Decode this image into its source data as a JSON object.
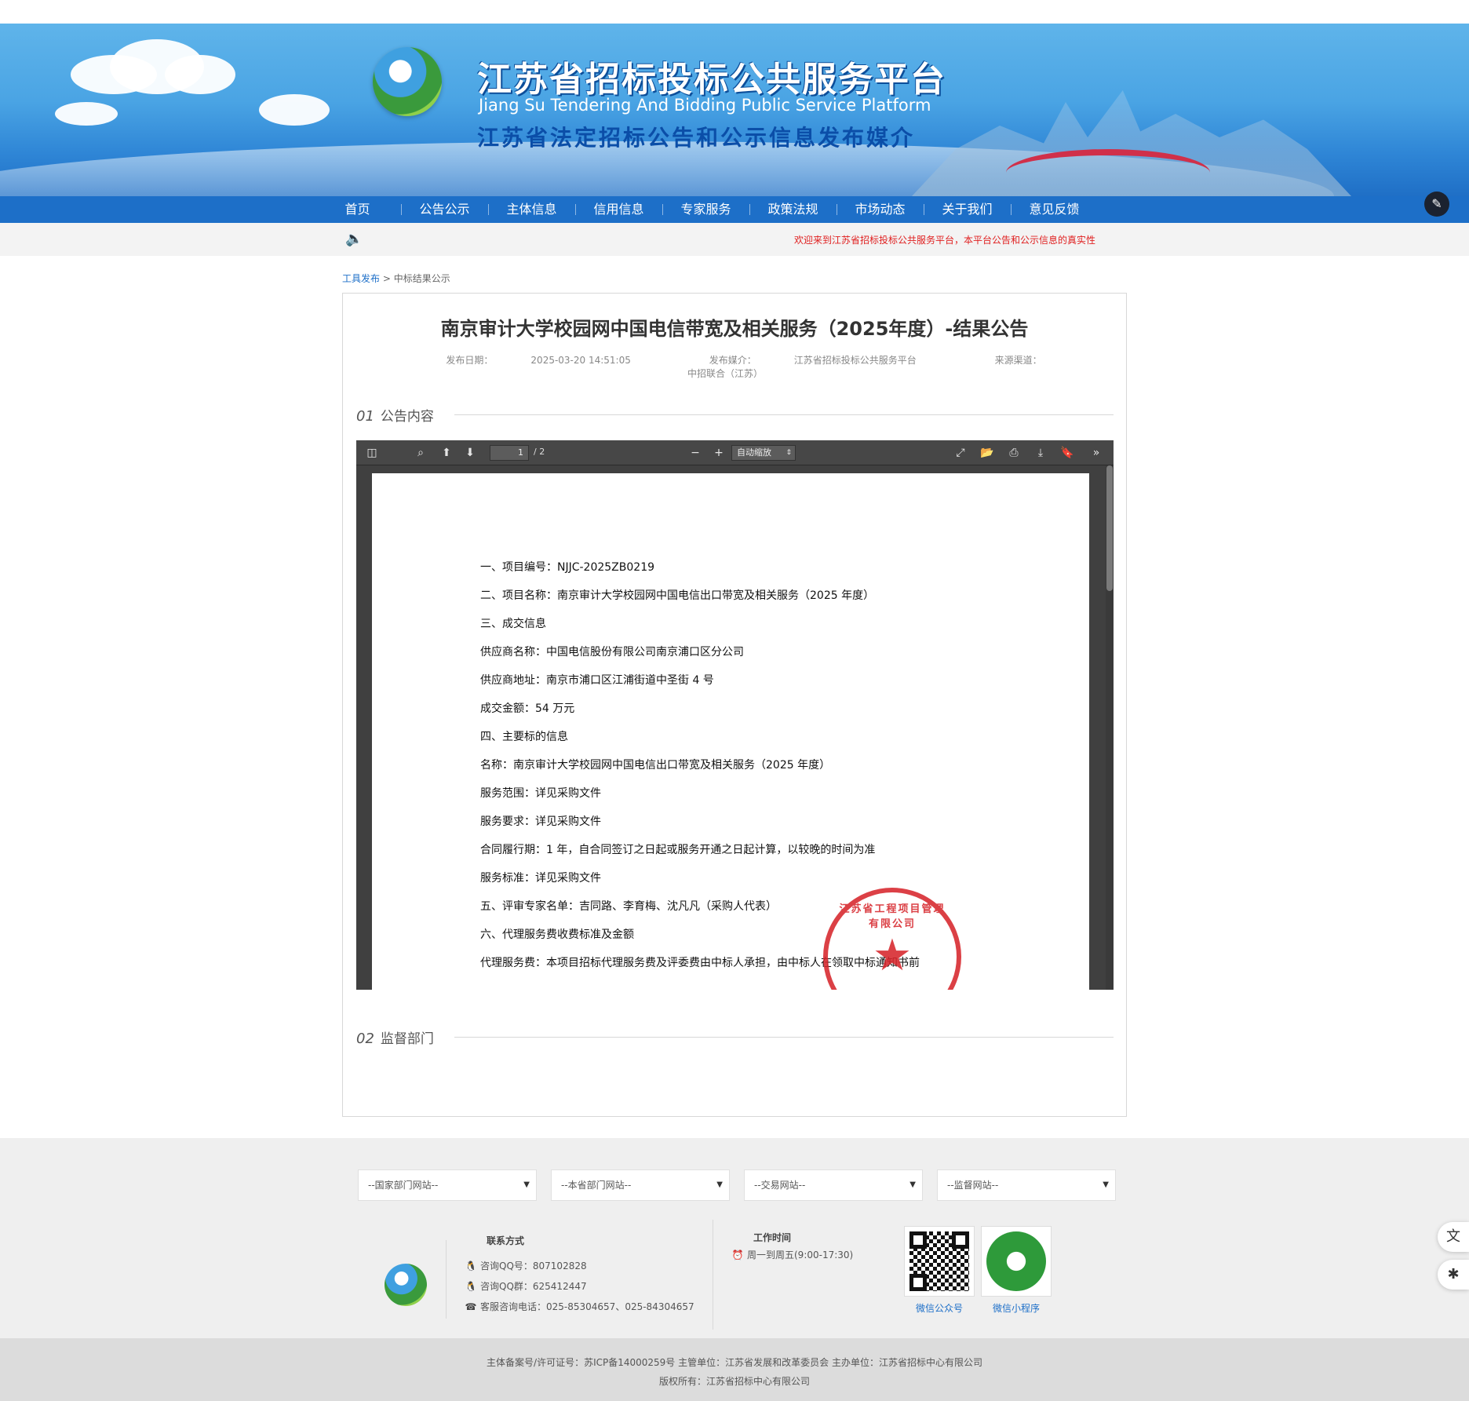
{
  "header": {
    "title": "江苏省招标投标公共服务平台",
    "subtitle_en": "Jiang Su Tendering And Bidding Public Service Platform",
    "subtitle_cn": "江苏省法定招标公告和公示信息发布媒介"
  },
  "nav": {
    "items": [
      "首页",
      "公告公示",
      "主体信息",
      "信用信息",
      "专家服务",
      "政策法规",
      "市场动态",
      "关于我们",
      "意见反馈"
    ]
  },
  "notice": {
    "text": "欢迎来到江苏省招标投标公共服务平台，本平台公告和公示信息的真实性"
  },
  "breadcrumb": {
    "link": "工具发布",
    "separator": ">",
    "current": "中标结果公示"
  },
  "article": {
    "title": "南京审计大学校园网中国电信带宽及相关服务（2025年度）-结果公告",
    "meta": {
      "date_label": "发布日期：",
      "date": "2025-03-20 14:51:05",
      "media_label": "发布媒介：",
      "media": "江苏省招标投标公共服务平台",
      "source_label": "来源渠道：",
      "source": "中招联合（江苏）"
    },
    "section1": {
      "num": "01",
      "label": "公告内容"
    },
    "section2": {
      "num": "02",
      "label": "监督部门"
    }
  },
  "pdf_viewer": {
    "page_current": "1",
    "page_total": "/ 2",
    "zoom": "自动缩放",
    "lines": [
      "一、项目编号：NJJC-2025ZB0219",
      "二、项目名称：南京审计大学校园网中国电信出口带宽及相关服务（2025 年度）",
      "三、成交信息",
      "供应商名称：中国电信股份有限公司南京浦口区分公司",
      "供应商地址：南京市浦口区江浦街道中圣街 4 号",
      "成交金额：54 万元",
      "四、主要标的信息",
      "名称：南京审计大学校园网中国电信出口带宽及相关服务（2025 年度）",
      "服务范围：详见采购文件",
      "服务要求：详见采购文件",
      "合同履行期：1 年，自合同签订之日起或服务开通之日起计算，以较晚的时间为准",
      "服务标准：详见采购文件",
      "五、评审专家名单：吉同路、李育梅、沈凡凡（采购人代表）",
      "六、代理服务费收费标准及金额",
      "代理服务费：本项目招标代理服务费及评委费由中标人承担，由中标人在领取中标通知书前"
    ],
    "stamp_text": "江苏省工程项目管理有限公司"
  },
  "footer": {
    "selects": [
      "--国家部门网站--",
      "--本省部门网站--",
      "--交易网站--",
      "--监督网站--"
    ],
    "contact": {
      "title": "联系方式",
      "qq": "咨询QQ号：807102828",
      "qq_group": "咨询QQ群：625412447",
      "phone": "客服咨询电话：025-85304657、025-84304657"
    },
    "hours": {
      "title": "工作时间",
      "text": "周一到周五(9:00-17:30)"
    },
    "qr": {
      "wechat_account": "微信公众号",
      "mini_program": "微信小程序"
    },
    "bottom_line1": "主体备案号/许可证号：苏ICP备14000259号 主管单位：江苏省发展和改革委员会 主办单位：江苏省招标中心有限公司",
    "bottom_line2": "版权所有：江苏省招标中心有限公司"
  },
  "colors": {
    "nav_bg": "#1d6fc8",
    "notice_text": "#e02020",
    "link": "#1d6fc8",
    "stamp": "#d7262c"
  },
  "icons": {
    "speaker": "speaker-icon",
    "sidebar_toggle": "sidebar-toggle-icon",
    "search": "search-icon",
    "prev": "arrow-up-icon",
    "next": "arrow-down-icon",
    "zoom_out": "minus-icon",
    "zoom_in": "plus-icon",
    "fullscreen": "fullscreen-icon",
    "open": "open-file-icon",
    "print": "print-icon",
    "download": "download-icon",
    "bookmark": "bookmark-icon",
    "more": "double-chevron-right-icon"
  }
}
